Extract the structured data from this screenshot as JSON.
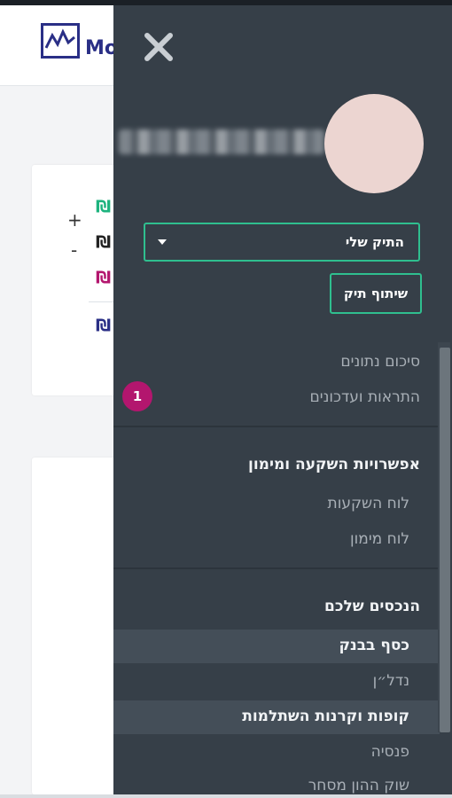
{
  "app": {
    "logo_text": "Mo"
  },
  "background_card": {
    "plus": "+",
    "minus": "-",
    "currency_symbol": "₪",
    "currency_colors": [
      "#1db37e",
      "#222222",
      "#b3166e",
      "#2a2f86"
    ]
  },
  "drawer": {
    "close_icon": "close-icon",
    "portfolio_select": {
      "value": "התיק שלי"
    },
    "share_button": "שיתוף תיק",
    "items": {
      "summary": "סיכום נתונים",
      "alerts": "התראות ועדכונים",
      "alerts_badge": "1",
      "investment_header": "אפשרויות השקעה ומימון",
      "investment_board": "לוח השקעות",
      "financing_board": "לוח מימון",
      "assets_header": "הנכסים שלכם",
      "bank_money": "כסף בבנק",
      "real_estate": "נדל״ן",
      "funds": "קופות וקרנות השתלמות",
      "pension": "פנסיה",
      "stock_market": "שוק ההון מסחר"
    }
  },
  "colors": {
    "drawer_bg": "#363f48",
    "accent_green": "#2fbf8f",
    "badge": "#b3166e",
    "avatar": "#ecd5d1",
    "brand": "#2a2f86"
  }
}
